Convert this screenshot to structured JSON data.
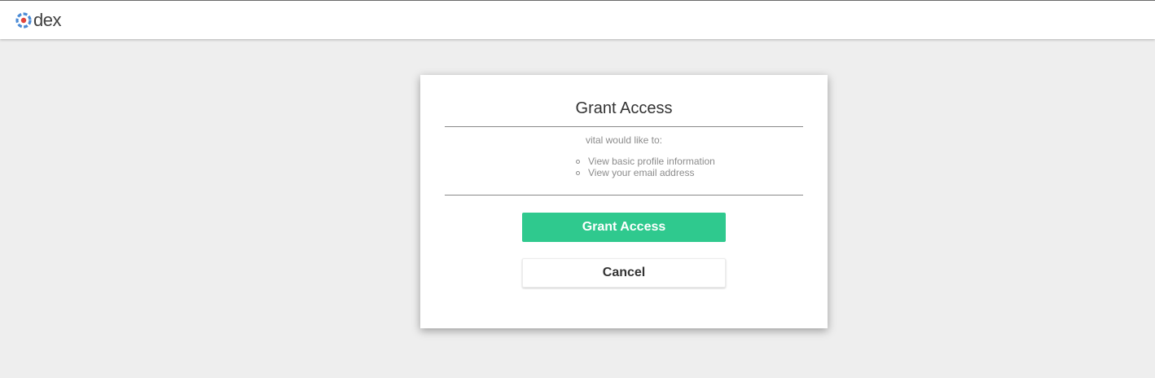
{
  "header": {
    "brand": "dex",
    "logo_icon": "dex-logo-icon",
    "logo_colors": [
      "#4b8bd6",
      "#e0443c"
    ]
  },
  "dialog": {
    "title": "Grant Access",
    "subtitle": "vital would like to:",
    "scopes": [
      "View basic profile information",
      "View your email address"
    ],
    "grant_label": "Grant Access",
    "cancel_label": "Cancel",
    "accent_color": "#2fc98e"
  }
}
